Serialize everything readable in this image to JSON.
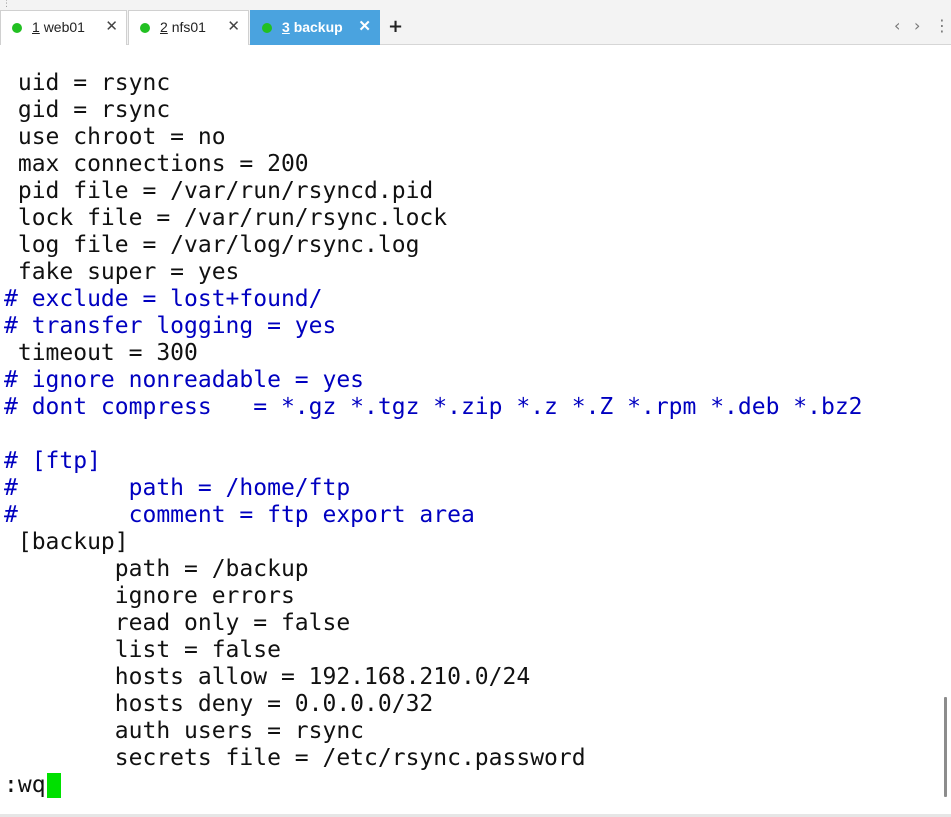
{
  "tabs": [
    {
      "num": "1",
      "name": "web01",
      "active": false,
      "status_color": "#22c022"
    },
    {
      "num": "2",
      "name": "nfs01",
      "active": false,
      "status_color": "#22c022"
    },
    {
      "num": "3",
      "name": "backup",
      "active": true,
      "status_color": "#22c022"
    }
  ],
  "tab_close_glyph": "✕",
  "new_tab_glyph": "+",
  "nav": {
    "prev": "‹",
    "next": "›",
    "menu": "⋮"
  },
  "terminal": {
    "lines": [
      {
        "text": "",
        "comment": false
      },
      {
        "text": " uid = rsync",
        "comment": false
      },
      {
        "text": " gid = rsync",
        "comment": false
      },
      {
        "text": " use chroot = no",
        "comment": false
      },
      {
        "text": " max connections = 200",
        "comment": false
      },
      {
        "text": " pid file = /var/run/rsyncd.pid",
        "comment": false
      },
      {
        "text": " lock file = /var/run/rsync.lock",
        "comment": false
      },
      {
        "text": " log file = /var/log/rsync.log",
        "comment": false
      },
      {
        "text": " fake super = yes",
        "comment": false
      },
      {
        "text": "# exclude = lost+found/",
        "comment": true
      },
      {
        "text": "# transfer logging = yes",
        "comment": true
      },
      {
        "text": " timeout = 300",
        "comment": false
      },
      {
        "text": "# ignore nonreadable = yes",
        "comment": true
      },
      {
        "text": "# dont compress   = *.gz *.tgz *.zip *.z *.Z *.rpm *.deb *.bz2",
        "comment": true
      },
      {
        "text": "",
        "comment": false
      },
      {
        "text": "# [ftp]",
        "comment": true
      },
      {
        "text": "#        path = /home/ftp",
        "comment": true
      },
      {
        "text": "#        comment = ftp export area",
        "comment": true
      },
      {
        "text": " [backup]",
        "comment": false
      },
      {
        "text": "        path = /backup",
        "comment": false
      },
      {
        "text": "        ignore errors",
        "comment": false
      },
      {
        "text": "        read only = false",
        "comment": false
      },
      {
        "text": "        list = false",
        "comment": false
      },
      {
        "text": "        hosts allow = 192.168.210.0/24",
        "comment": false
      },
      {
        "text": "        hosts deny = 0.0.0.0/32",
        "comment": false
      },
      {
        "text": "        auth users = rsync",
        "comment": false
      },
      {
        "text": "        secrets file = /etc/rsync.password",
        "comment": false
      },
      {
        "text": ":wq",
        "comment": false
      }
    ],
    "cursor_color": "#00e000",
    "comment_color": "#0000c0",
    "text_color": "#111111"
  },
  "colors": {
    "active_tab": "#4aa3df",
    "status_dot": "#22c022"
  }
}
